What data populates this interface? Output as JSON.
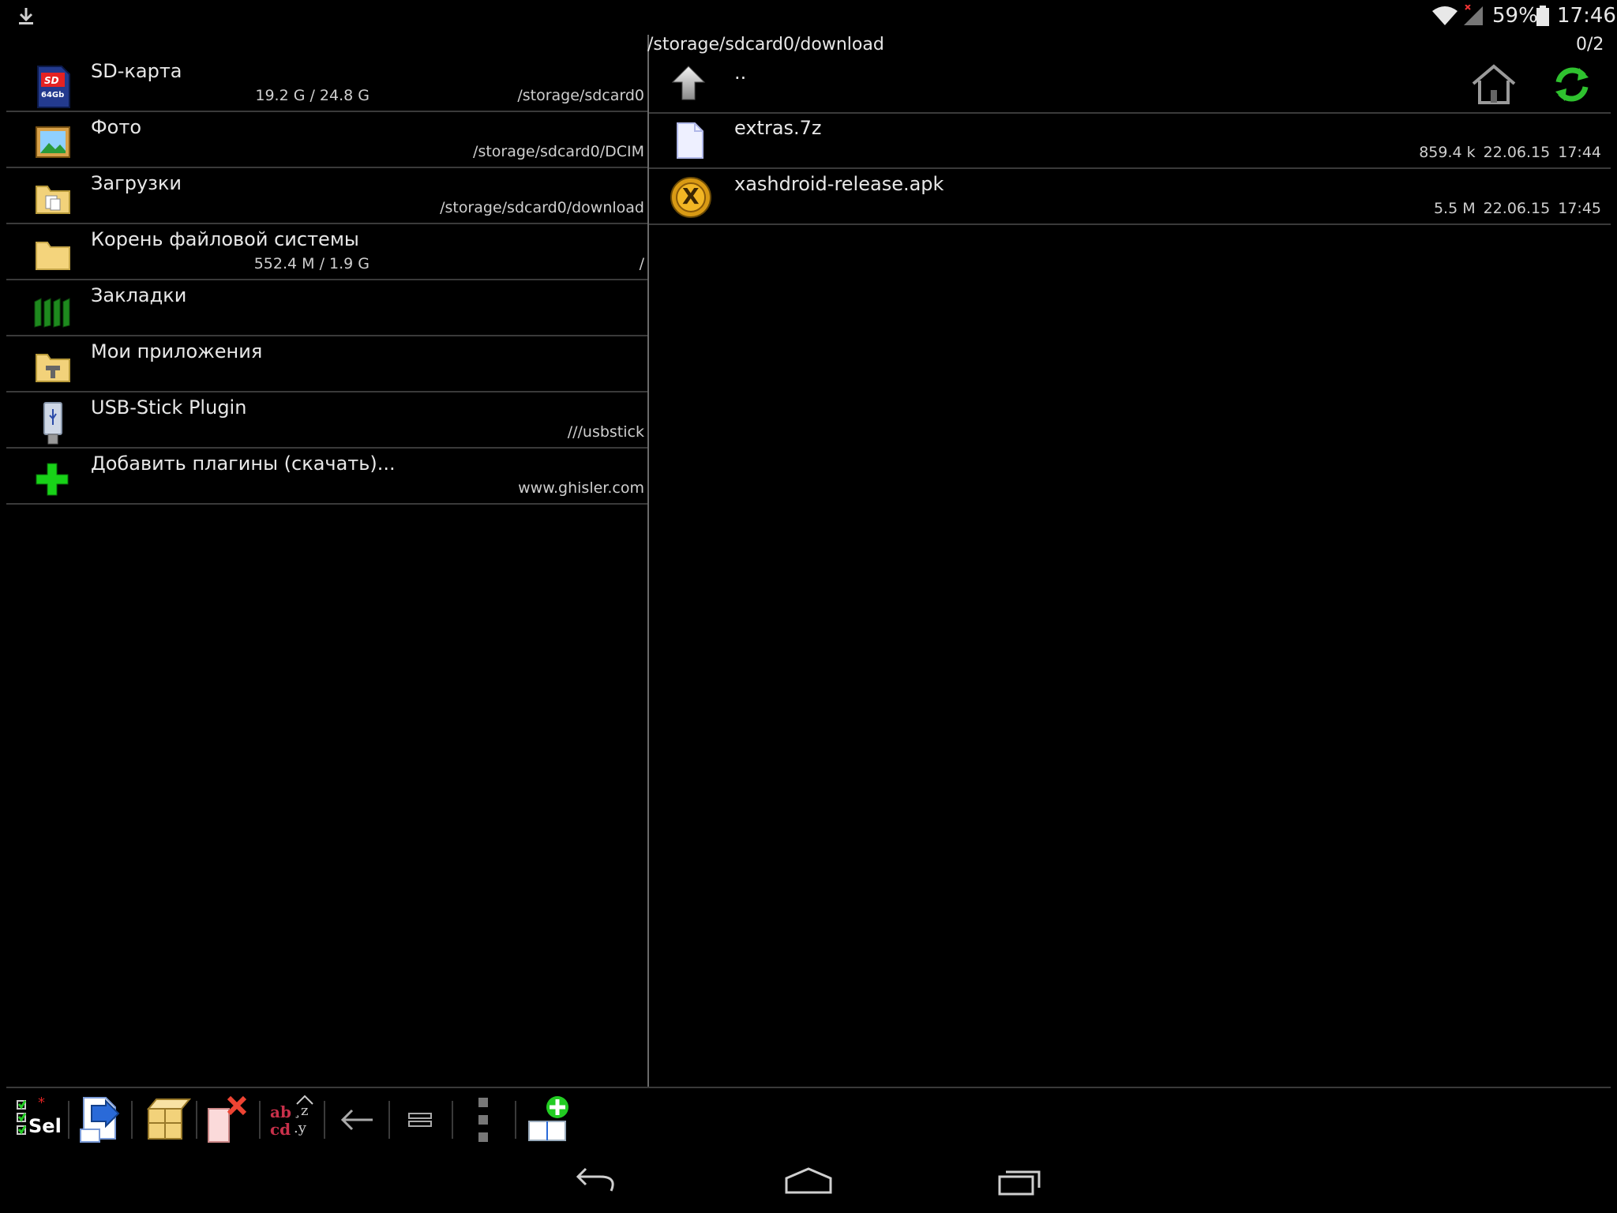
{
  "status_bar": {
    "download_icon": "download-arrow-icon",
    "battery": "59%",
    "time": "17:46"
  },
  "left_panel": {
    "items": [
      {
        "title": "SD-карта",
        "size": "19.2 G / 24.8 G",
        "path": "/storage/sdcard0",
        "icon": "sd-card-icon",
        "icon_text": "64Gb"
      },
      {
        "title": "Фото",
        "size": "",
        "path": "/storage/sdcard0/DCIM",
        "icon": "photo-icon"
      },
      {
        "title": "Загрузки",
        "size": "",
        "path": "/storage/sdcard0/download",
        "icon": "downloads-folder-icon"
      },
      {
        "title": "Корень файловой системы",
        "size": "552.4 M / 1.9 G",
        "path": "/",
        "icon": "folder-icon"
      },
      {
        "title": "Закладки",
        "size": "",
        "path": "",
        "icon": "bookmarks-icon"
      },
      {
        "title": "Мои приложения",
        "size": "",
        "path": "",
        "icon": "apps-folder-icon"
      },
      {
        "title": "USB-Stick Plugin",
        "size": "",
        "path": "///usbstick",
        "icon": "usb-stick-icon"
      },
      {
        "title": "Добавить плагины (скачать)...",
        "size": "",
        "path": "www.ghisler.com",
        "icon": "add-plugin-icon"
      }
    ]
  },
  "right_panel": {
    "path": "/storage/sdcard0/download",
    "count": "0/2",
    "up_label": "..",
    "files": [
      {
        "name": "extras.7z",
        "size": "859.4 k",
        "date": "22.06.15",
        "time": "17:44",
        "icon": "file-icon"
      },
      {
        "name": "xashdroid-release.apk",
        "size": "5.5 M",
        "date": "22.06.15",
        "time": "17:45",
        "icon": "xash-app-icon",
        "icon_letter": "X"
      }
    ]
  },
  "toolbar": {
    "select_label": "Sel",
    "sort_label_top": "ab",
    "sort_label_bottom": "cd",
    "sort_suffix_top": "¸z",
    "sort_suffix_bottom": ".y"
  },
  "colors": {
    "background": "#000000",
    "green_accent": "#22cc22",
    "folder_yellow": "#f2d27a"
  }
}
